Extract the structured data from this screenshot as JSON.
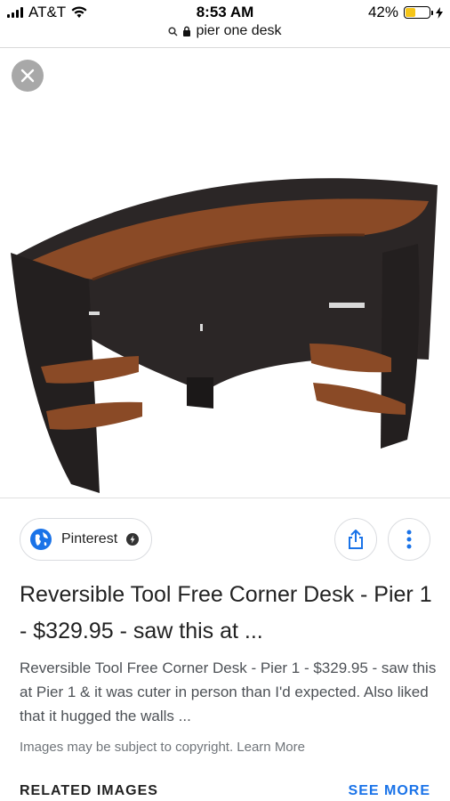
{
  "status_bar": {
    "carrier": "AT&T",
    "time": "8:53 AM",
    "battery_percent": "42%",
    "battery_level": 0.42
  },
  "url_bar": {
    "url": "pier one desk"
  },
  "image": {
    "icon": "corner-desk-product-image"
  },
  "source": {
    "label": "Pinterest"
  },
  "result": {
    "title": "Reversible Tool Free Corner Desk - Pier 1 - $329.95 - saw this at ...",
    "description": "Reversible Tool Free Corner Desk - Pier 1 - $329.95 - saw this at Pier 1 & it was cuter in person than I'd expected. Also liked that it hugged the walls ...",
    "copyright": "Images may be subject to copyright. Learn More"
  },
  "related": {
    "label": "RELATED IMAGES",
    "see_more": "SEE MORE"
  },
  "colors": {
    "accent": "#1a73e8",
    "desk_wood": "#8a4a26",
    "desk_body": "#2b2626"
  }
}
